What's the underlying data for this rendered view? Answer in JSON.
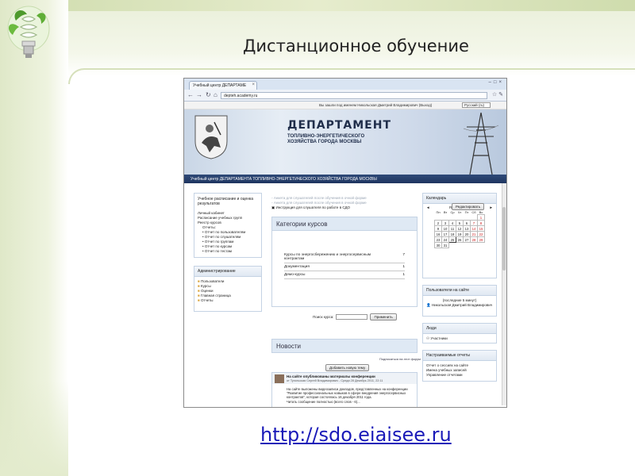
{
  "slide": {
    "title": "Дистанционное обучение",
    "url": "http://sdo.eiaisee.ru"
  },
  "browser": {
    "tab_title": "Учебный центр ДЕПАРТАМЕ",
    "address": "depteh.academy.ru"
  },
  "userbar": {
    "login_text": "Вы зашли под именем Никольская Дмитрий Владимирович (Выход)",
    "language": "Русский (ru)"
  },
  "banner": {
    "title": "ДЕПАРТАМЕНТ",
    "subtitle": "ТОПЛИВНО-ЭНЕРГЕТИЧЕСКОГО ХОЗЯЙСТВА ГОРОДА МОСКВЫ",
    "edit_label": "Редактировать"
  },
  "navstrip": "Учебный центр ДЕПАРТАМЕНТА ТОПЛИВНО-ЭНЕРГЕТИЧЕСКОГО ХОЗЯЙСТВА ГОРОДА МОСКВЫ",
  "left_block1": {
    "title": "Учебное расписание и оценка результатов",
    "items": [
      "Личный кабинет",
      "Расписание учебных групп",
      "Реестр курсов",
      "Отчеты:"
    ],
    "reports": [
      "Отчет по пользователям",
      "Отчет по слушателям",
      "Отчет по группам",
      "Отчет по курсам",
      "Отчет по тестам"
    ]
  },
  "left_block2": {
    "title": "Администрирование",
    "items": [
      "Пользователи",
      "Курсы",
      "Оценки",
      "Главная страница",
      "Отчеты"
    ]
  },
  "center": {
    "notice1": "Анкета для слушателей после обучения в очной форме",
    "notice2": "Анкета для слушателей после обучения в очной форме",
    "notice3": "Инструкция для слушателя по работе в СДО",
    "categories_title": "Категории курсов",
    "categories": [
      {
        "name": "Курсы по энергосбережению и энергосервисным контрактам",
        "count": "7"
      },
      {
        "name": "Документация",
        "count": "1"
      },
      {
        "name": "Демо-курсы",
        "count": "1"
      }
    ],
    "search_label": "Поиск курса:",
    "search_button": "Применить",
    "news_title": "Новости",
    "news_subscribe": "Подписаться на этот форум",
    "news_add": "Добавить новую тему",
    "post": {
      "title": "На сайте опубликованы материалы конференции",
      "meta": "от Тугольская Сергей Владимирович - Среда 28 Декабрь 2011, 22:11",
      "body": "На сайте выложены видеозаписи докладов, представленных на конференции \"Развитие профессиональных навыков в сфере внедрения энергосервисных контрактов\", которая состоялась 16 декабря 2011 года.",
      "more": "Читать сообщение полностью (всего слов - 6)..."
    }
  },
  "calendar": {
    "title": "Календарь",
    "month": "Январь 2012",
    "weekdays": [
      "Пн",
      "Вт",
      "Ср",
      "Чт",
      "Пт",
      "Сб",
      "Вс"
    ],
    "weeks": [
      [
        "",
        "",
        "",
        "",
        "",
        "",
        "1"
      ],
      [
        "2",
        "3",
        "4",
        "5",
        "6",
        "7",
        "8"
      ],
      [
        "9",
        "10",
        "11",
        "12",
        "13",
        "14",
        "15"
      ],
      [
        "16",
        "17",
        "18",
        "19",
        "20",
        "21",
        "22"
      ],
      [
        "23",
        "24",
        "25",
        "26",
        "27",
        "28",
        "29"
      ],
      [
        "30",
        "31",
        "",
        "",
        "",
        "",
        ""
      ]
    ]
  },
  "online_block": {
    "title": "Пользователи на сайте",
    "subtitle": "(последние 5 минут)",
    "user": "Никольская Дмитрий Владимирович"
  },
  "people_block": {
    "title": "Люди",
    "item": "Участники"
  },
  "reports_block": {
    "title": "Настраиваемые отчеты",
    "items": [
      "Отчет о сессиях на сайте",
      "Имена учебных записей",
      "Управление отчетами"
    ]
  }
}
